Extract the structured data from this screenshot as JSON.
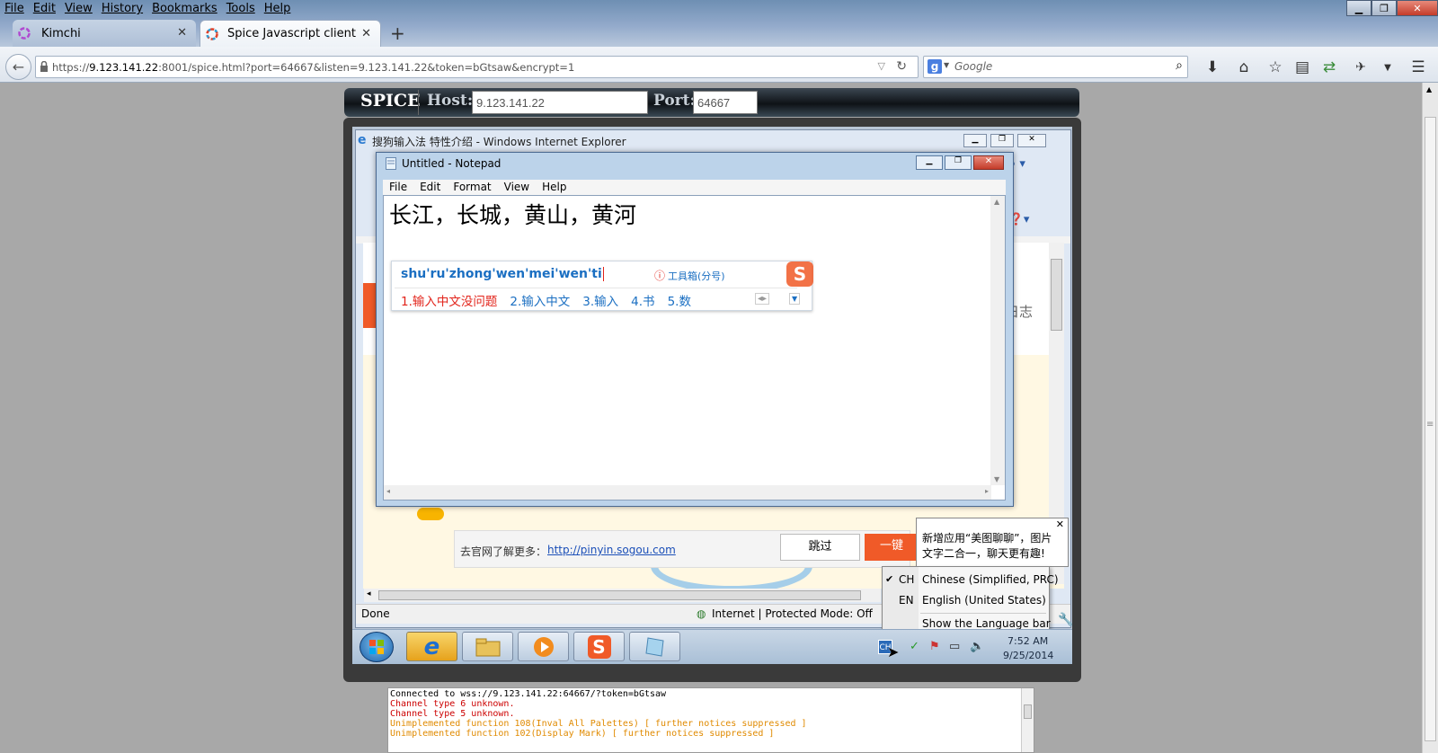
{
  "firefox": {
    "menu": [
      "File",
      "Edit",
      "View",
      "History",
      "Bookmarks",
      "Tools",
      "Help"
    ],
    "tabs": [
      {
        "title": "Kimchi",
        "active": false
      },
      {
        "title": "Spice Javascript client",
        "active": true
      }
    ],
    "url": {
      "scheme": "https://",
      "host": "9.123.141.22",
      "rest": ":8001/spice.html?port=64667&listen=9.123.141.22&token=bGtsaw&encrypt=1"
    },
    "search_placeholder": "Google"
  },
  "spice": {
    "logo": "SPICE",
    "host_label": "Host:",
    "host_value": "9.123.141.22",
    "port_label": "Port:",
    "port_value": "64667"
  },
  "ie": {
    "title": "搜狗输入法 特性介绍 - Windows Internet Explorer",
    "status_done": "Done",
    "status_zone": "Internet | Protected Mode: Off",
    "partial_text": "级日志",
    "promo_label": "去官网了解更多：",
    "promo_link": "http://pinyin.sogou.com",
    "skip_button": "跳过",
    "onekey_button": "一键"
  },
  "notepad": {
    "title": "Untitled - Notepad",
    "menu": [
      "File",
      "Edit",
      "Format",
      "View",
      "Help"
    ],
    "content": "长江，长城，黄山，黄河"
  },
  "ime": {
    "pinyin": "shu'ru'zhong'wen'mei'wen'ti",
    "toolbox": "工具箱(分号)",
    "candidates": [
      "1.输入中文没问题",
      "2.输入中文",
      "3.输入",
      "4.书",
      "5.数"
    ]
  },
  "balloon": {
    "line1": "新增应用“美图聊聊”，图片",
    "line2": "文字二合一，聊天更有趣!"
  },
  "language_menu": {
    "items": [
      {
        "code": "CH",
        "label": "Chinese (Simplified, PRC)",
        "checked": true
      },
      {
        "code": "EN",
        "label": "English (United States)",
        "checked": false
      }
    ],
    "show_bar": "Show the Language bar"
  },
  "clock": {
    "time": "7:52 AM",
    "date": "9/25/2014"
  },
  "console": {
    "lines": [
      {
        "text": "Connected to wss://9.123.141.22:64667/?token=bGtsaw",
        "color": "#000000"
      },
      {
        "text": "Channel type 6 unknown.",
        "color": "#cc0000"
      },
      {
        "text": "Channel type 5 unknown.",
        "color": "#cc0000"
      },
      {
        "text": "Unimplemented function 108(Inval All Palettes) [ further notices suppressed ]",
        "color": "#e08a00"
      },
      {
        "text": "Unimplemented function 102(Display Mark) [ further notices suppressed ]",
        "color": "#e08a00"
      }
    ]
  },
  "colors": {
    "ime_blue": "#1b6fc2",
    "ime_red": "#e2231a",
    "sogou_orange": "#f05a28"
  }
}
